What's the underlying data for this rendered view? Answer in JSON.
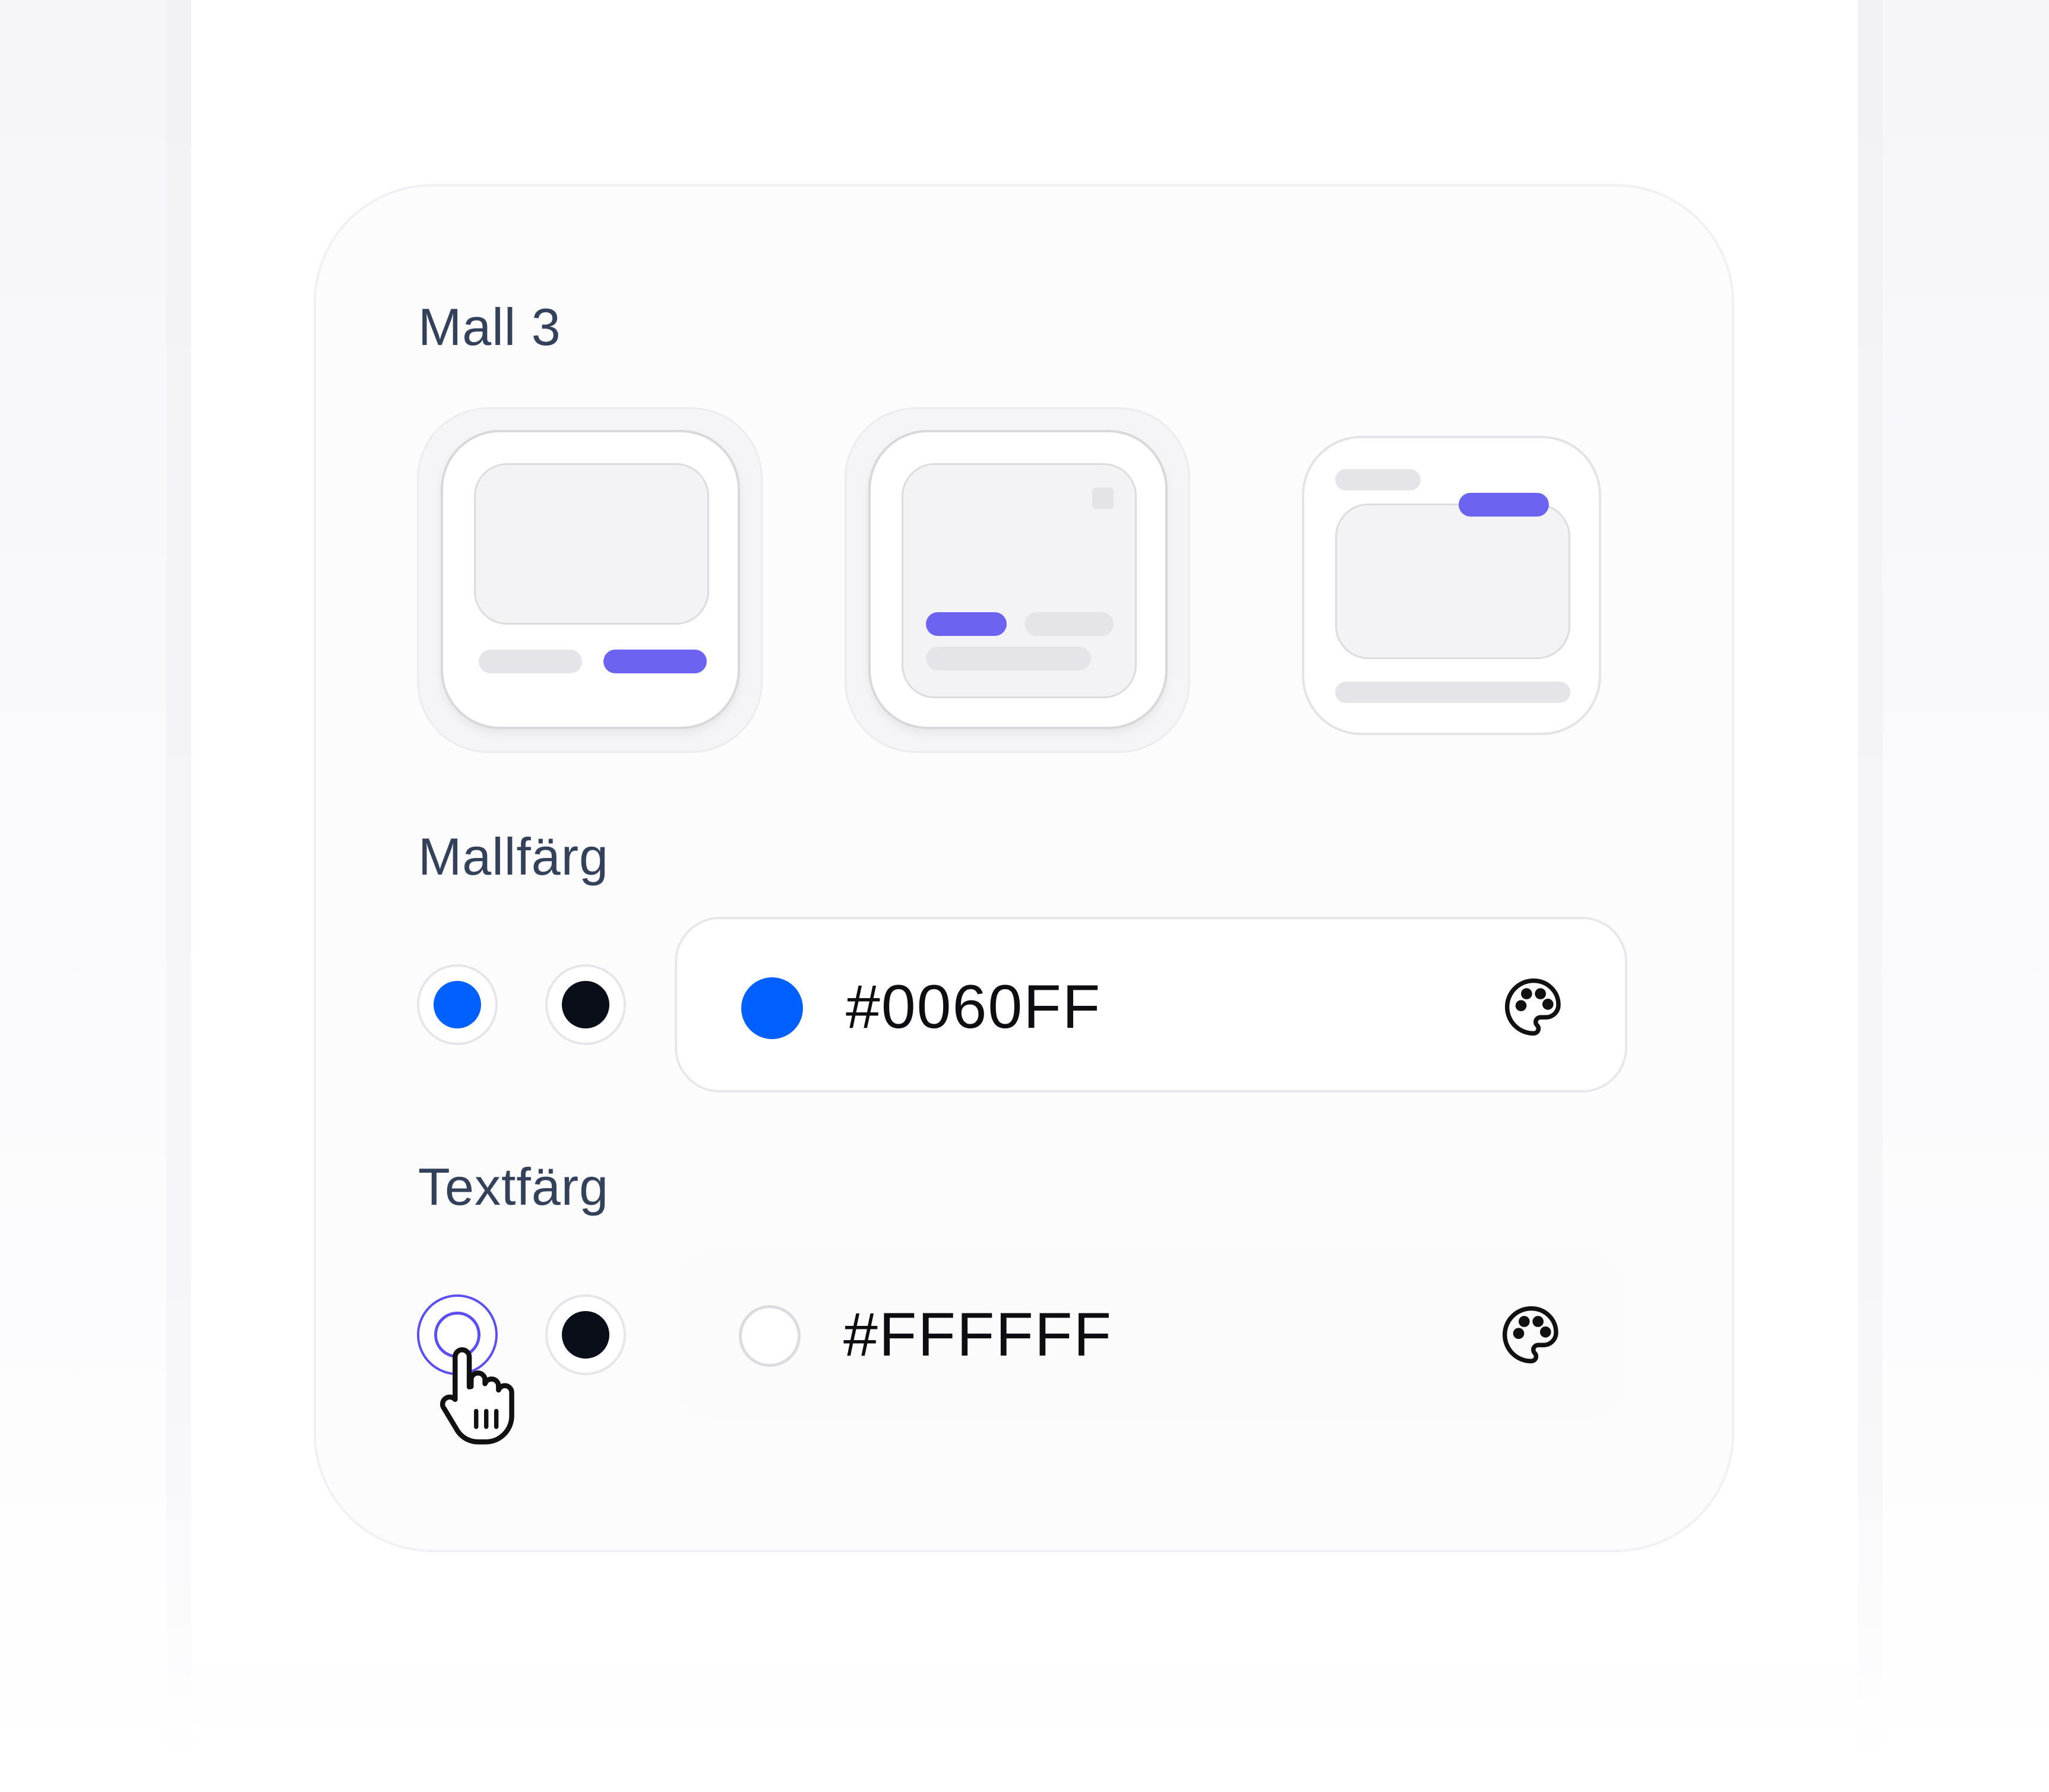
{
  "colors": {
    "accent": "#6C63F0",
    "blue": "#0060FF",
    "black": "#0A0E18",
    "white": "#FFFFFF",
    "selection_ring": "#5B4FF0"
  },
  "template_section": {
    "label": "Mall 3",
    "templates": [
      {
        "name": "template-1",
        "selected": false
      },
      {
        "name": "template-2",
        "selected": false
      },
      {
        "name": "template-3",
        "selected": true
      }
    ]
  },
  "template_color": {
    "label": "Mallfärg",
    "swatches": [
      {
        "name": "blue",
        "color": "#0060FF",
        "selected": true
      },
      {
        "name": "black",
        "color": "#0A0E18",
        "selected": false
      }
    ],
    "field": {
      "value": "#0060FF",
      "preview_color": "#0060FF",
      "icon": "palette-icon"
    }
  },
  "text_color": {
    "label": "Textfärg",
    "swatches": [
      {
        "name": "white",
        "color": "#FFFFFF",
        "selected": true
      },
      {
        "name": "black",
        "color": "#0A0E18",
        "selected": false
      }
    ],
    "field": {
      "value": "#FFFFFF",
      "preview_color": "#FFFFFF",
      "icon": "palette-icon"
    }
  },
  "cursor": {
    "icon": "hand-pointer-icon"
  }
}
